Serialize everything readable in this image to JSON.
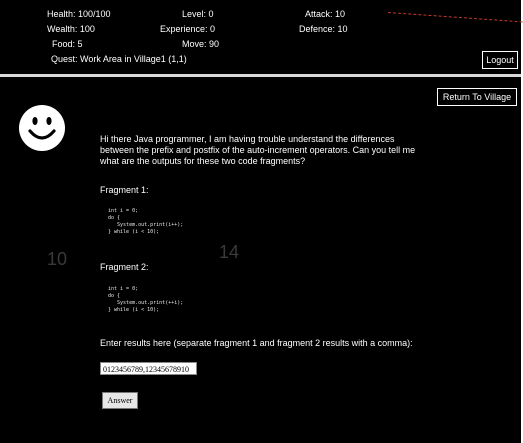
{
  "stats": {
    "health": "Health: 100/100",
    "level": "Level: 0",
    "attack": "Attack: 10",
    "wealth": "Wealth: 100",
    "experience": "Experience: 0",
    "defence": "Defence: 10",
    "food": "Food: 5",
    "move": "Move: 90",
    "quest": "Quest: Work Area in Village1 (1,1)"
  },
  "logout_label": "Logout",
  "return_label": "Return To Village",
  "question": "Hi there Java programmer, I am having trouble understand the differences between the prefix and postfix of the auto-increment operators. Can you tell me what are the outputs for these two code fragments?",
  "fragment1": {
    "label": "Fragment 1:",
    "code": "int i = 0;\ndo {\n   System.out.print(i++);\n} while (i < 10);"
  },
  "fragment2": {
    "label": "Fragment 2:",
    "code": "int i = 0;\ndo {\n   System.out.print(++i);\n} while (i < 10);"
  },
  "ghost_numbers": {
    "left": "10",
    "right": "14"
  },
  "prompt": "Enter results here (separate fragment 1 and fragment 2 results with a comma):",
  "answer_value": "0123456789,12345678910",
  "answer_button": "Answer",
  "colors": {
    "background": "#000000",
    "text": "#ffffff",
    "divider": "#d9d9d9"
  },
  "icons": {
    "avatar": "smiley-face-icon"
  }
}
